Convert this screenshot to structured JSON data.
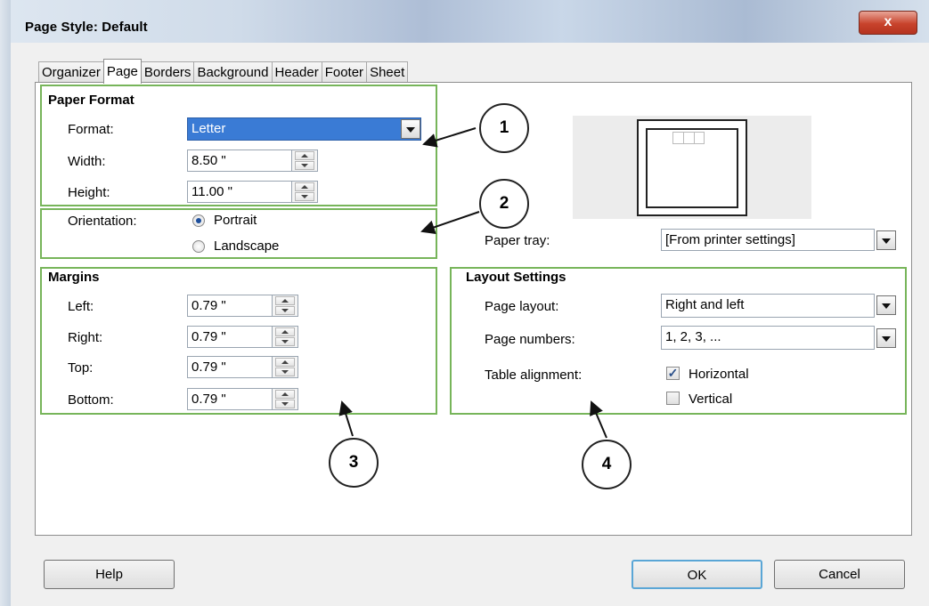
{
  "window": {
    "title": "Page Style: Default",
    "close_symbol": "x"
  },
  "tabs": [
    "Organizer",
    "Page",
    "Borders",
    "Background",
    "Header",
    "Footer",
    "Sheet"
  ],
  "active_tab": "Page",
  "paper_format": {
    "heading": "Paper Format",
    "format_label": "Format:",
    "format_value": "Letter",
    "width_label": "Width:",
    "width_value": "8.50 \"",
    "height_label": "Height:",
    "height_value": "11.00 \""
  },
  "orientation": {
    "label": "Orientation:",
    "portrait": "Portrait",
    "landscape": "Landscape",
    "selected": "Portrait"
  },
  "paper_tray": {
    "label": "Paper tray:",
    "value": "[From printer settings]"
  },
  "margins": {
    "heading": "Margins",
    "left_label": "Left:",
    "left_value": "0.79 \"",
    "right_label": "Right:",
    "right_value": "0.79 \"",
    "top_label": "Top:",
    "top_value": "0.79 \"",
    "bottom_label": "Bottom:",
    "bottom_value": "0.79 \""
  },
  "layout": {
    "heading": "Layout Settings",
    "page_layout_label": "Page layout:",
    "page_layout_value": "Right and left",
    "page_numbers_label": "Page numbers:",
    "page_numbers_value": "1, 2, 3, ...",
    "table_alignment_label": "Table alignment:",
    "horizontal": "Horizontal",
    "horizontal_checked": true,
    "vertical": "Vertical",
    "vertical_checked": false
  },
  "callouts": [
    "1",
    "2",
    "3",
    "4"
  ],
  "buttons": {
    "help": "Help",
    "ok": "OK",
    "cancel": "Cancel"
  },
  "colors": {
    "highlight_box": "#77b55a",
    "selection": "#3a7bd5"
  }
}
